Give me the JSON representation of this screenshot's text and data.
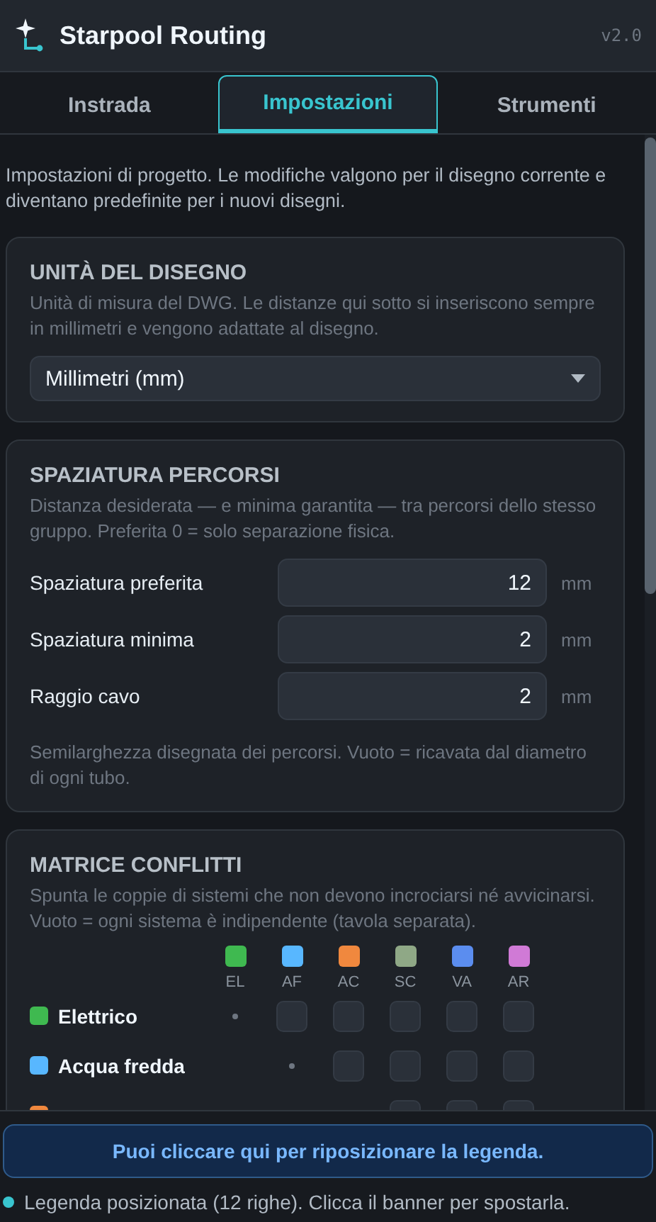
{
  "header": {
    "title": "Starpool Routing",
    "version": "v2.0"
  },
  "tabs": [
    {
      "label": "Instrada",
      "selected": false
    },
    {
      "label": "Impostazioni",
      "selected": true
    },
    {
      "label": "Strumenti",
      "selected": false
    }
  ],
  "intro": "Impostazioni di progetto. Le modifiche valgono per il disegno corrente e diventano predefinite per i nuovi disegni.",
  "units": {
    "title": "UNITÀ DEL DISEGNO",
    "help": "Unità di misura del DWG. Le distanze qui sotto si inseriscono sempre in millimetri e vengono adattate al disegno.",
    "value": "Millimetri (mm)"
  },
  "spacing": {
    "title": "SPAZIATURA PERCORSI",
    "help": "Distanza desiderata — e minima garantita — tra percorsi dello stesso gruppo. Preferita 0 = solo separazione fisica.",
    "fields": [
      {
        "label": "Spaziatura preferita",
        "value": "12",
        "unit": "mm"
      },
      {
        "label": "Spaziatura minima",
        "value": "2",
        "unit": "mm"
      },
      {
        "label": "Raggio cavo",
        "value": "2",
        "unit": "mm"
      }
    ],
    "note": "Semilarghezza disegnata dei percorsi. Vuoto = ricavata dal diametro di ogni tubo."
  },
  "matrix": {
    "title": "MATRICE CONFLITTI",
    "help": "Spunta le coppie di sistemi che non devono incrociarsi né avvicinarsi. Vuoto = ogni sistema è indipendente (tavola separata).",
    "columns": [
      {
        "code": "EL",
        "color": "#3fb950"
      },
      {
        "code": "AF",
        "color": "#58b7ff"
      },
      {
        "code": "AC",
        "color": "#f0883e"
      },
      {
        "code": "SC",
        "color": "#8fa886"
      },
      {
        "code": "VA",
        "color": "#5b8def"
      },
      {
        "code": "AR",
        "color": "#d07ad6"
      }
    ],
    "rows": [
      {
        "label": "Elettrico",
        "color": "#3fb950",
        "boxes": [
          {
            "checked": false
          },
          {
            "checked": false
          },
          {
            "checked": false
          },
          {
            "checked": false
          },
          {
            "checked": false
          }
        ]
      },
      {
        "label": "Acqua fredda",
        "color": "#58b7ff",
        "boxes": [
          {
            "checked": false
          },
          {
            "checked": false
          },
          {
            "checked": false
          },
          {
            "checked": false
          }
        ]
      },
      {
        "color": "#f0883e",
        "boxes": [
          {
            "checked": false
          },
          {
            "checked": false
          },
          {
            "checked": false
          }
        ]
      }
    ]
  },
  "banner": "Puoi cliccare qui per riposizionare la legenda.",
  "status": "Legenda posizionata (12 righe). Clicca il banner per spostarla."
}
